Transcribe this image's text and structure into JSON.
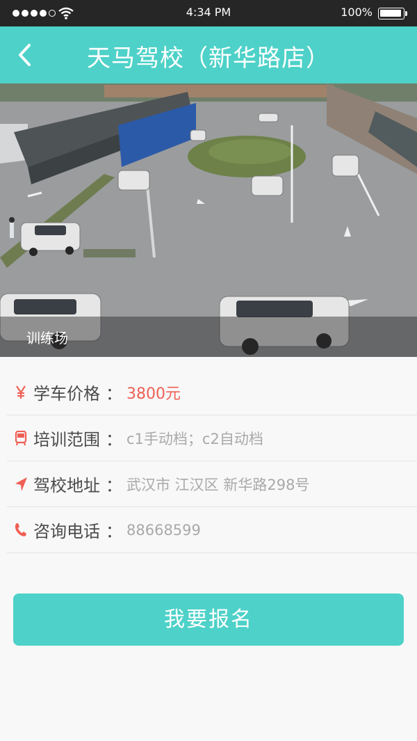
{
  "status_bar": {
    "time": "4:34 PM",
    "battery": "100%"
  },
  "header": {
    "title": "天马驾校（新华路店）"
  },
  "hero": {
    "caption": "训练场"
  },
  "info": [
    {
      "icon": "yen-icon",
      "label": "学车价格",
      "colon": "：",
      "value": "3800元",
      "highlight": true
    },
    {
      "icon": "bus-icon",
      "label": "培训范围",
      "colon": "：",
      "value": "c1手动档；c2自动档",
      "highlight": false
    },
    {
      "icon": "location-arrow-icon",
      "label": "驾校地址",
      "colon": "：",
      "value": "武汉市 江汉区 新华路298号",
      "highlight": false
    },
    {
      "icon": "phone-icon",
      "label": "咨询电话",
      "colon": "：",
      "value": "88668599",
      "highlight": false
    }
  ],
  "signup": {
    "label": "我要报名"
  },
  "colors": {
    "accent": "#4ed1c8",
    "price": "#ef5f55",
    "icon": "#ef5f55"
  }
}
